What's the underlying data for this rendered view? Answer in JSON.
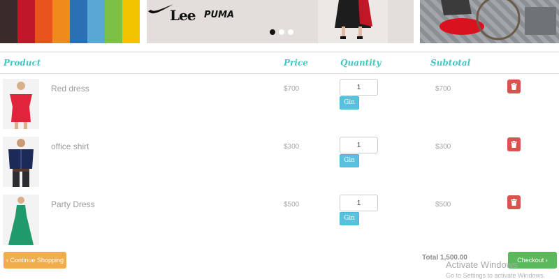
{
  "banner": {
    "brands": {
      "lee": "Lee",
      "puma": "PUMA"
    },
    "carousel_active_index": 0,
    "carousel_count": 3
  },
  "table": {
    "headers": {
      "product": "Product",
      "price": "Price",
      "quantity": "Quantity",
      "subtotal": "Subtotal"
    },
    "rows": [
      {
        "name": "Red dress",
        "price": "$700",
        "quantity": "1",
        "update_label": "Gin",
        "subtotal": "$700",
        "dress_color": "#e0243b"
      },
      {
        "name": "office shirt",
        "price": "$300",
        "quantity": "1",
        "update_label": "Gin",
        "subtotal": "$300",
        "dress_color": "#1c2a5a"
      },
      {
        "name": "Party Dress",
        "price": "$500",
        "quantity": "1",
        "update_label": "Gin",
        "subtotal": "$500",
        "dress_color": "#1f9a6a"
      }
    ]
  },
  "footer": {
    "continue_label": "‹ Continue Shopping",
    "total_label": "Total 1,500.00",
    "checkout_label": "Checkout ›"
  },
  "watermark": {
    "title": "Activate Windows",
    "subtitle": "Go to Settings to activate Windows."
  },
  "colors": {
    "accent_heading": "#44c4c2",
    "update_button": "#5bc0de",
    "delete_button": "#d9534f",
    "continue_button": "#f0ad4e",
    "checkout_button": "#5cb85c"
  },
  "icons": {
    "delete": "trash-icon",
    "brand_nike": "nike-swoosh-icon"
  }
}
